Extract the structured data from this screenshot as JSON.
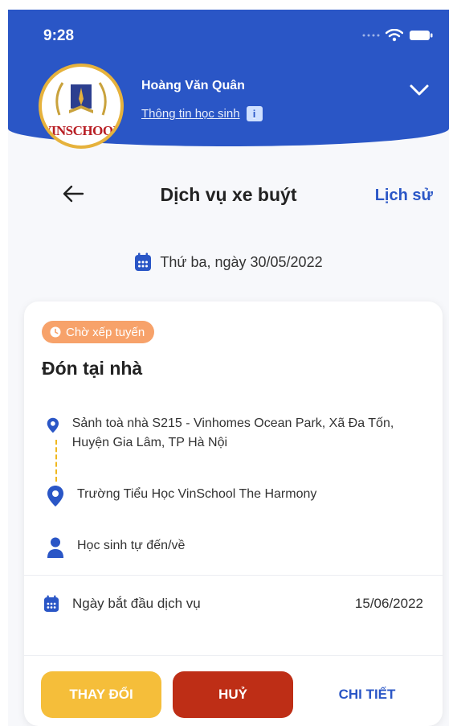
{
  "status_bar": {
    "time": "9:28"
  },
  "header": {
    "user_name": "Hoàng Văn Quân",
    "student_info_link": "Thông tin học sinh",
    "info_badge": "i",
    "school_logo_text": "VINSCHOOL",
    "colors": {
      "primary": "#2a56c6",
      "logo_border": "#e6b23c"
    }
  },
  "nav": {
    "title": "Dịch vụ xe buýt",
    "history_link": "Lịch sử"
  },
  "date": {
    "text": "Thứ ba, ngày 30/05/2022"
  },
  "card": {
    "status_badge": "Chờ xếp tuyến",
    "title": "Đón tại nhà",
    "pickup_address": "Sảnh toà nhà S215 - Vinhomes Ocean Park, Xã Đa Tốn, Huyện Gia Lâm, TP Hà Nội",
    "destination": "Trường Tiểu Học VinSchool The Harmony",
    "transport_mode": "Học sinh tự đến/về",
    "start_date_label": "Ngày bắt đầu dịch vụ",
    "start_date_value": "15/06/2022",
    "buttons": {
      "change": "THAY ĐỔI",
      "cancel": "HUỶ",
      "detail": "CHI TIẾT"
    },
    "colors": {
      "badge": "#f7a26a",
      "change": "#f5be3a",
      "cancel": "#be2e16",
      "link": "#2a56c6",
      "route_line": "#f0b81e"
    }
  },
  "icons": {
    "back": "arrow-left-icon",
    "chevron": "chevron-down-icon",
    "calendar": "calendar-icon",
    "location": "location-pin-icon",
    "person": "person-icon",
    "clock": "clock-icon"
  }
}
